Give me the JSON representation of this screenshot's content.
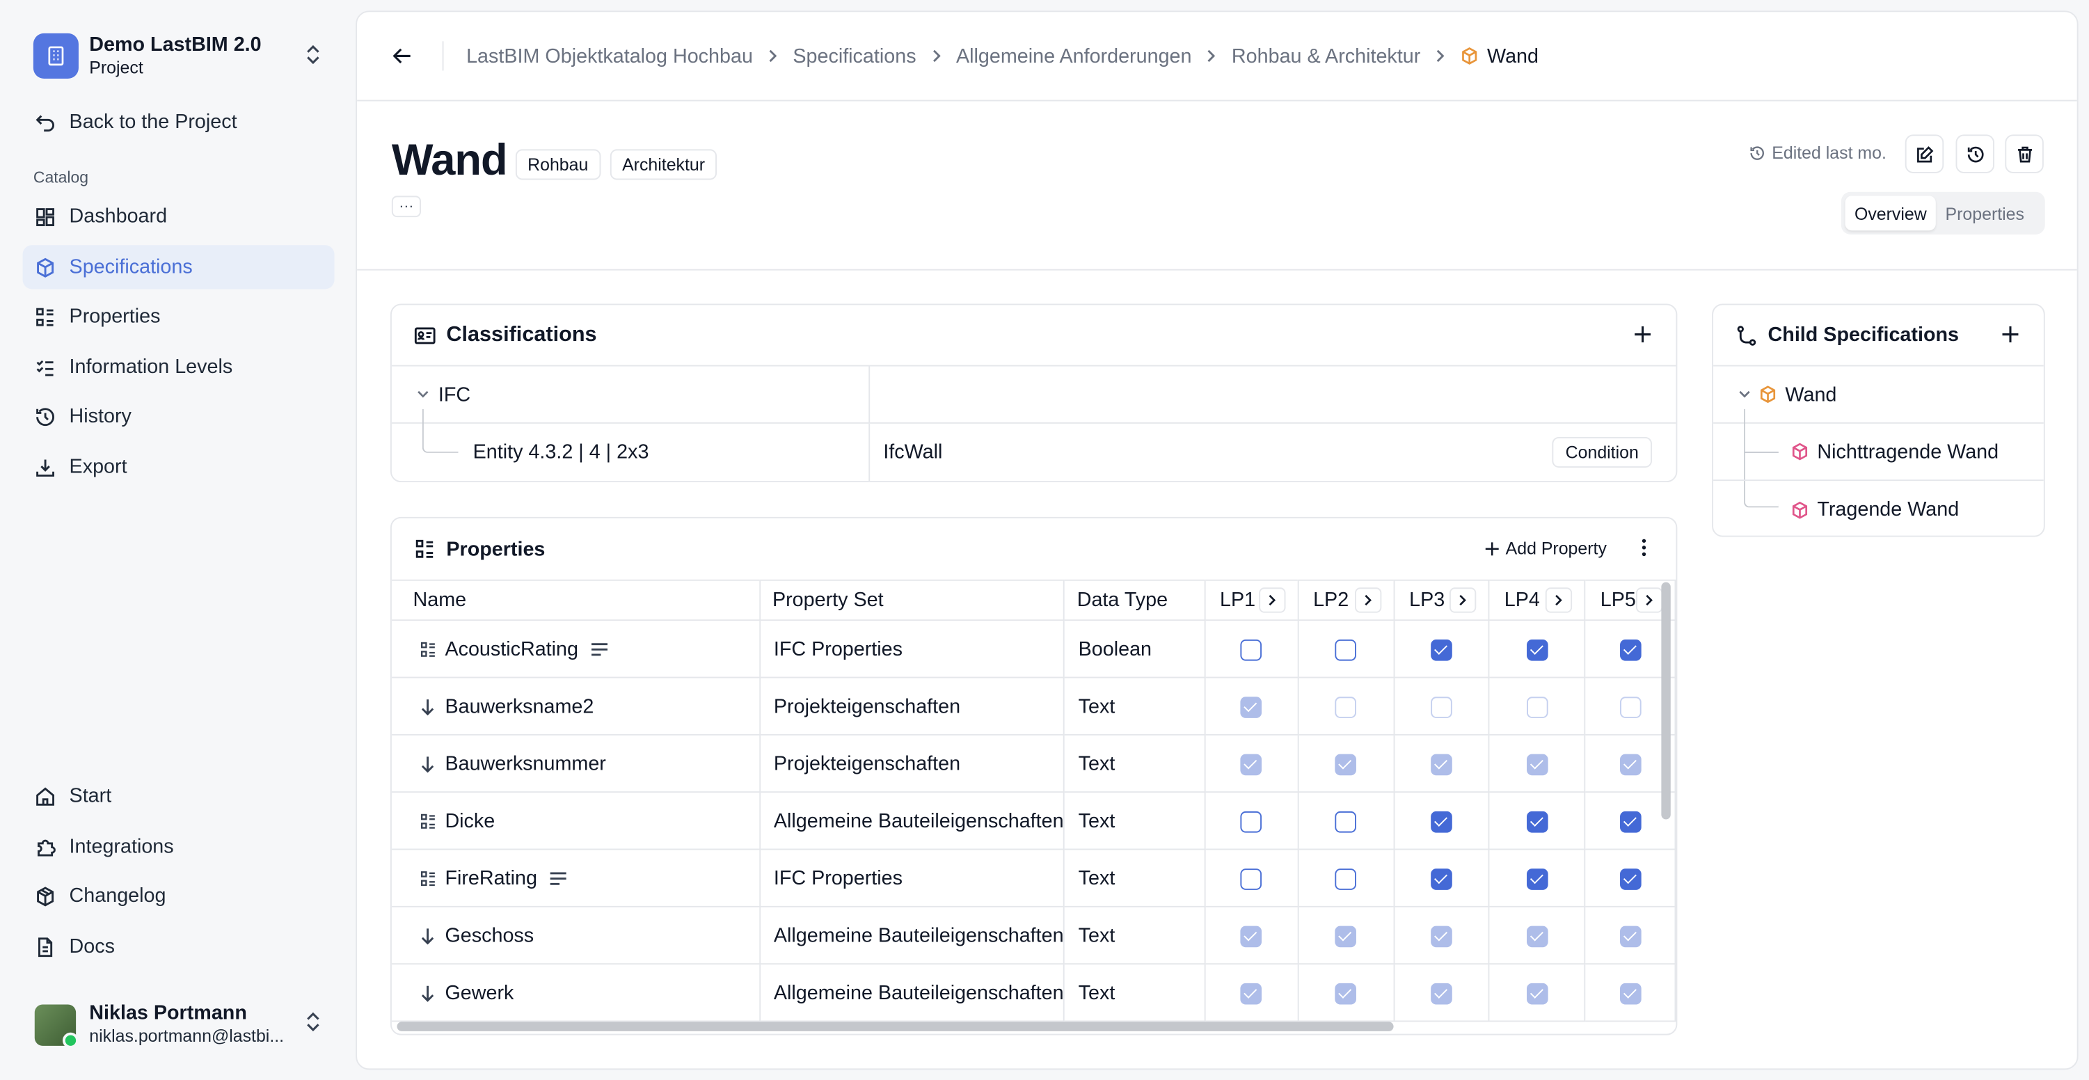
{
  "project": {
    "name": "Demo LastBIM 2.0",
    "type": "Project"
  },
  "nav": {
    "back": "Back to the Project",
    "section": "Catalog",
    "items": [
      {
        "label": "Dashboard",
        "icon": "dashboard-icon"
      },
      {
        "label": "Specifications",
        "icon": "cube-icon"
      },
      {
        "label": "Properties",
        "icon": "list-icon"
      },
      {
        "label": "Information Levels",
        "icon": "checklist-icon"
      },
      {
        "label": "History",
        "icon": "history-icon"
      },
      {
        "label": "Export",
        "icon": "download-icon"
      }
    ],
    "bottom": [
      {
        "label": "Start",
        "icon": "home-icon"
      },
      {
        "label": "Integrations",
        "icon": "puzzle-icon"
      },
      {
        "label": "Changelog",
        "icon": "package-icon"
      },
      {
        "label": "Docs",
        "icon": "document-icon"
      }
    ]
  },
  "user": {
    "name": "Niklas Portmann",
    "email": "niklas.portmann@lastbi..."
  },
  "breadcrumb": [
    "LastBIM Objektkatalog Hochbau",
    "Specifications",
    "Allgemeine Anforderungen",
    "Rohbau & Architektur",
    "Wand"
  ],
  "page": {
    "title": "Wand",
    "tags": [
      "Rohbau",
      "Architektur"
    ],
    "more": "···",
    "edited": "Edited last mo.",
    "tabs": [
      "Overview",
      "Properties"
    ]
  },
  "classifications": {
    "title": "Classifications",
    "group": "IFC",
    "entity": "Entity 4.3.2 | 4 | 2x3",
    "value": "IfcWall",
    "condition": "Condition"
  },
  "properties": {
    "title": "Properties",
    "add": "Add Property",
    "columns": [
      "Name",
      "Property Set",
      "Data Type",
      "LP1",
      "LP2",
      "LP3",
      "LP4",
      "LP5"
    ],
    "rows": [
      {
        "name": "AcousticRating",
        "kind": "own",
        "note": true,
        "set": "IFC Properties",
        "type": "Boolean",
        "lp": [
          "empty",
          "empty",
          "checked",
          "checked",
          "checked"
        ]
      },
      {
        "name": "Bauwerksname2",
        "kind": "inherited",
        "note": false,
        "set": "Projekteigenschaften",
        "type": "Text",
        "lp": [
          "dim-checked",
          "dim-empty",
          "dim-empty",
          "dim-empty",
          "dim-empty"
        ]
      },
      {
        "name": "Bauwerksnummer",
        "kind": "inherited",
        "note": false,
        "set": "Projekteigenschaften",
        "type": "Text",
        "lp": [
          "dim-checked",
          "dim-checked",
          "dim-checked",
          "dim-checked",
          "dim-checked"
        ]
      },
      {
        "name": "Dicke",
        "kind": "own",
        "note": false,
        "set": "Allgemeine Bauteileigenschaften",
        "type": "Text",
        "lp": [
          "empty",
          "empty",
          "checked",
          "checked",
          "checked"
        ]
      },
      {
        "name": "FireRating",
        "kind": "own",
        "note": true,
        "set": "IFC Properties",
        "type": "Text",
        "lp": [
          "empty",
          "empty",
          "checked",
          "checked",
          "checked"
        ]
      },
      {
        "name": "Geschoss",
        "kind": "inherited",
        "note": false,
        "set": "Allgemeine Bauteileigenschaften",
        "type": "Text",
        "lp": [
          "dim-checked",
          "dim-checked",
          "dim-checked",
          "dim-checked",
          "dim-checked"
        ]
      },
      {
        "name": "Gewerk",
        "kind": "inherited",
        "note": false,
        "set": "Allgemeine Bauteileigenschaften",
        "type": "Text",
        "lp": [
          "dim-checked",
          "dim-checked",
          "dim-checked",
          "dim-checked",
          "dim-checked"
        ]
      }
    ]
  },
  "children": {
    "title": "Child Specifications",
    "root": "Wand",
    "items": [
      "Nichttragende Wand",
      "Tragende Wand"
    ]
  },
  "colors": {
    "accent": "#4a6fd6",
    "orange": "#e8953a",
    "pink": "#e0558a"
  }
}
